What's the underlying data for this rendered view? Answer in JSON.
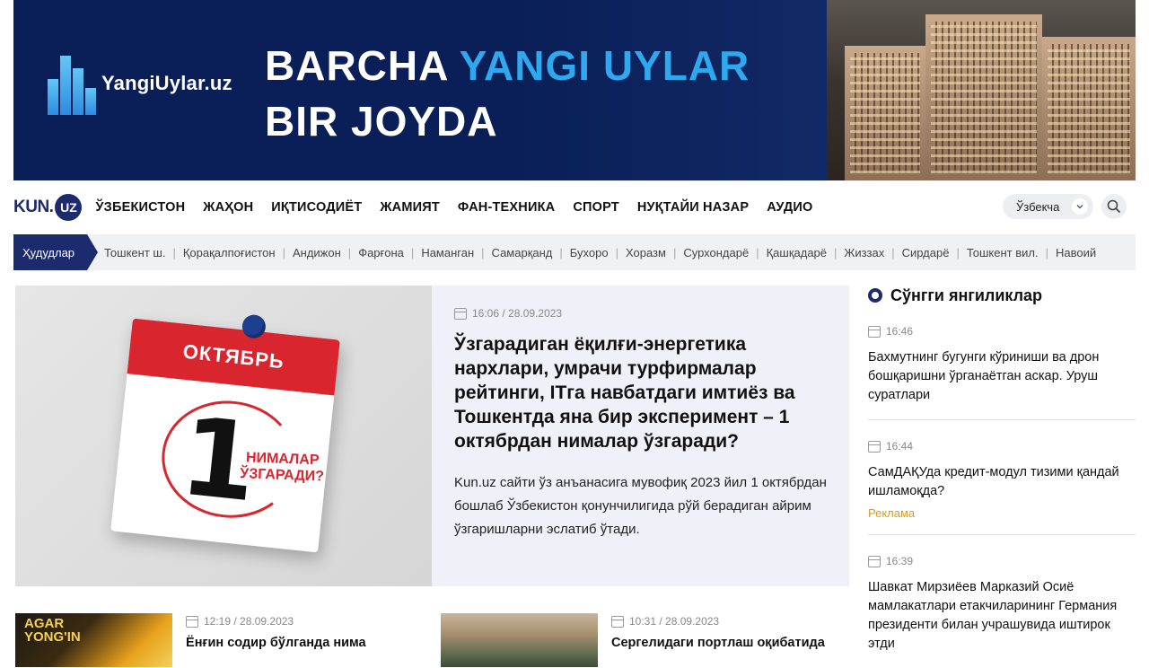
{
  "banner": {
    "logo_text": "YangiUylar.uz",
    "line1_white": "BARCHA",
    "line1_accent": "YANGI UYLAR",
    "line2": "BIR JOYDA",
    "colors": {
      "background": "#0a1f57",
      "accent": "#2ea8ee"
    }
  },
  "header": {
    "brand_kun": "KUN.",
    "brand_uz": "UZ",
    "nav": [
      "ЎЗБЕКИСТОН",
      "ЖАҲОН",
      "ИҚТИСОДИЁТ",
      "ЖАМИЯТ",
      "ФАН-ТЕХНИКА",
      "СПОРТ",
      "НУҚТАЙИ НАЗАР",
      "АУДИО"
    ],
    "language": "Ўзбекча",
    "icons": {
      "language_toggle": "chevron-down-icon",
      "search": "search-icon"
    }
  },
  "regions": {
    "label": "Ҳудудлар",
    "items": [
      "Тошкент ш.",
      "Қорақалпоғистон",
      "Андижон",
      "Фарғона",
      "Наманган",
      "Самарқанд",
      "Бухоро",
      "Хоразм",
      "Сурхондарё",
      "Қашқадарё",
      "Жиззах",
      "Сирдарё",
      "Тошкент вил.",
      "Навоий"
    ]
  },
  "featured": {
    "image": {
      "month": "ОКТЯБРЬ",
      "day": "1",
      "caption_line1": "НИМАЛАР",
      "caption_line2": "ЎЗГАРАДИ?"
    },
    "datetime": "16:06 / 28.09.2023",
    "title": "Ўзгарадиган ёқилғи-энергетика нархлари, умрачи турфирмалар рейтинги, ITга навбатдаги имтиёз ва Тошкентда яна бир эксперимент – 1 октябрдан нималар ўзгаради?",
    "description": "Kun.uz сайти ўз анъанасига мувофиқ 2023 йил 1 октябрдан бошлаб Ўзбекистон қонунчилигида рўй берадиган айрим ўзгаришларни эслатиб ўтади."
  },
  "latest": {
    "title": "Сўнгги янгиликлар",
    "items": [
      {
        "time": "16:46",
        "title": "Бахмутнинг бугунги кўриниши ва дрон бошқаришни ўрганаётган аскар. Уруш суратлари",
        "ad": ""
      },
      {
        "time": "16:44",
        "title": "СамДАҚУда кредит-модул тизими қандай ишламоқда?",
        "ad": "Реклама"
      },
      {
        "time": "16:39",
        "title": "Шавкат Мирзиёев Марказий Осиё мамлакатлари етакчиларининг Германия президенти билан учрашувида иштирок этди",
        "ad": ""
      }
    ]
  },
  "cards": [
    {
      "datetime": "12:19 / 28.09.2023",
      "title": "Ёнғин содир бўлганда нима",
      "image_text": "AGAR YONG'IN"
    },
    {
      "datetime": "10:31 / 28.09.2023",
      "title": "Сергелидаги портлаш оқибатида",
      "image_text": ""
    }
  ]
}
